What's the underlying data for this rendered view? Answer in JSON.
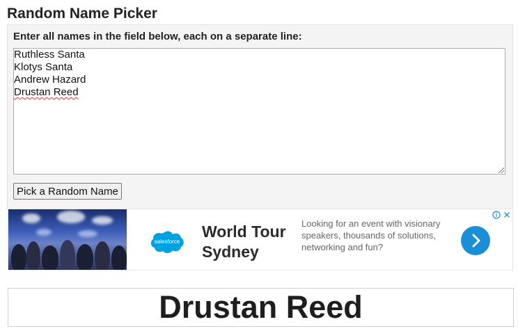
{
  "page": {
    "title": "Random Name Picker"
  },
  "form": {
    "label": "Enter all names in the field below, each on a separate line:",
    "names": [
      "Ruthless Santa",
      "Klotys Santa",
      "Andrew Hazard",
      "Drustan Reed"
    ],
    "pick_button_label": "Pick a Random Name"
  },
  "ad": {
    "logo_text": "salesforce",
    "headline": "World Tour Sydney",
    "body": "Looking for an event with visionary speakers, thousands of solutions, networking and fun?",
    "info_icon": "info-icon",
    "close_icon": "close-icon",
    "cta_icon": "chevron-right-icon",
    "accent_color": "#1a8fd8",
    "logo_color": "#00a1e0"
  },
  "result": {
    "picked_name": "Drustan Reed"
  }
}
